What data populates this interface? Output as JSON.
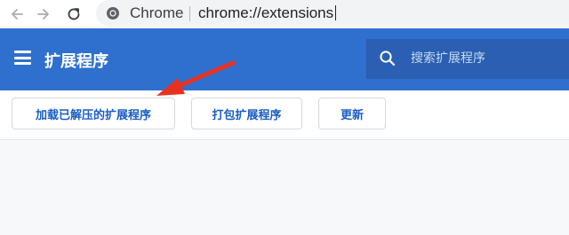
{
  "browser": {
    "site_chip": "Chrome",
    "url": "chrome://extensions",
    "icons": {
      "back": "back-arrow-icon",
      "forward": "forward-arrow-icon",
      "reload": "reload-icon",
      "site": "chrome-icon"
    }
  },
  "header": {
    "title": "扩展程序",
    "search_placeholder": "搜索扩展程序",
    "menu_icon": "hamburger-menu-icon",
    "search_icon": "search-icon",
    "background_color": "#2f70cf"
  },
  "actions": {
    "load_unpacked": "加载已解压的扩展程序",
    "pack_extension": "打包扩展程序",
    "update": "更新",
    "accent_color": "#1a5dc4"
  },
  "annotation": {
    "arrow_icon": "red-arrow-icon",
    "arrow_color": "#e8321f"
  }
}
